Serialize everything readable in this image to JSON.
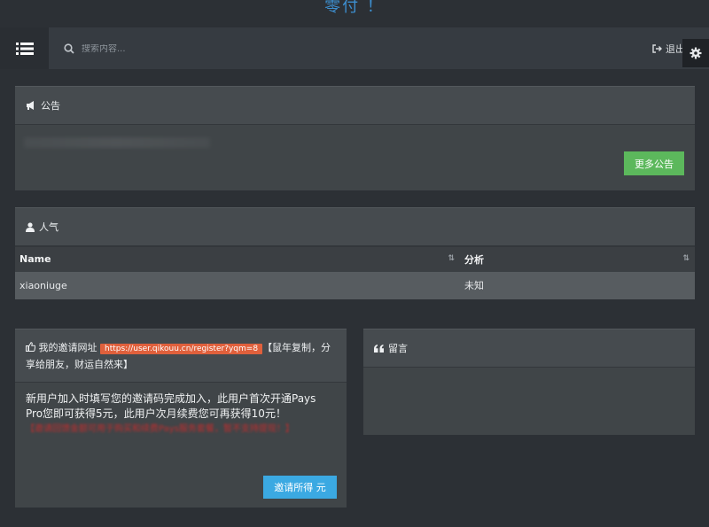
{
  "brand": {
    "title": "零付 ！"
  },
  "navbar": {
    "search_placeholder": "搜索内容...",
    "logout_label": "退出"
  },
  "notice": {
    "title": "公告",
    "more_button": "更多公告"
  },
  "popular": {
    "title": "人气",
    "columns": [
      "Name",
      "分析"
    ],
    "rows": [
      [
        "xiaoniuge",
        "未知"
      ]
    ]
  },
  "invite": {
    "label": "我的邀请网址",
    "url": "https://user.qikouu.cn/register?yqm=8",
    "hint": "【鼠年复制，分享给朋友，财运自然来】",
    "desc": "新用户加入时填写您的邀请码完成加入，此用户首次开通Pays Pro您即可获得5元，此用户次月续费您可再获得10元！",
    "red_note": "【邀请回馈金额可用于购买和续费Pays服务套餐，暂不支持提现！】",
    "button": "邀请所得 元"
  },
  "message": {
    "title": "留言"
  },
  "colors": {
    "accent_blue": "#3ba9e2",
    "brand_blue": "#3d8fd0",
    "success_green": "#5cb85c",
    "url_orange": "#e0603c",
    "warning_red": "#d42a2a"
  }
}
